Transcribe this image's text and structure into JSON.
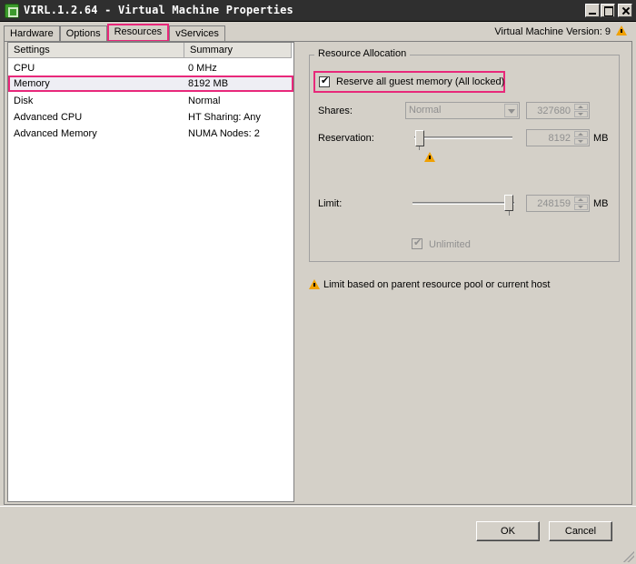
{
  "window": {
    "title": "VIRL.1.2.64 - Virtual Machine Properties",
    "vm_version": "Virtual Machine Version: 9",
    "highlight_color": "#e8287a"
  },
  "tabs": [
    {
      "label": "Hardware",
      "active": false
    },
    {
      "label": "Options",
      "active": false
    },
    {
      "label": "Resources",
      "active": true
    },
    {
      "label": "vServices",
      "active": false
    }
  ],
  "settings": {
    "headers": [
      "Settings",
      "Summary"
    ],
    "rows": [
      {
        "setting": "CPU",
        "summary": "0 MHz"
      },
      {
        "setting": "Memory",
        "summary": "8192 MB",
        "selected": true
      },
      {
        "setting": "Disk",
        "summary": "Normal"
      },
      {
        "setting": "Advanced CPU",
        "summary": "HT Sharing: Any"
      },
      {
        "setting": "Advanced Memory",
        "summary": "NUMA Nodes: 2"
      }
    ]
  },
  "resource_allocation": {
    "legend": "Resource Allocation",
    "reserve_all_label": "Reserve all guest memory (All locked)",
    "reserve_all_checked": true,
    "shares_label": "Shares:",
    "shares_value": "Normal",
    "shares_amount": "327680",
    "reservation_label": "Reservation:",
    "reservation_value": "8192",
    "reservation_unit": "MB",
    "limit_label": "Limit:",
    "limit_value": "248159",
    "limit_unit": "MB",
    "unlimited_label": "Unlimited",
    "unlimited_checked": true
  },
  "note": {
    "text": "Limit based on parent resource pool or current host",
    "icon": "warning-triangle-icon"
  },
  "buttons": {
    "ok": "OK",
    "cancel": "Cancel"
  }
}
